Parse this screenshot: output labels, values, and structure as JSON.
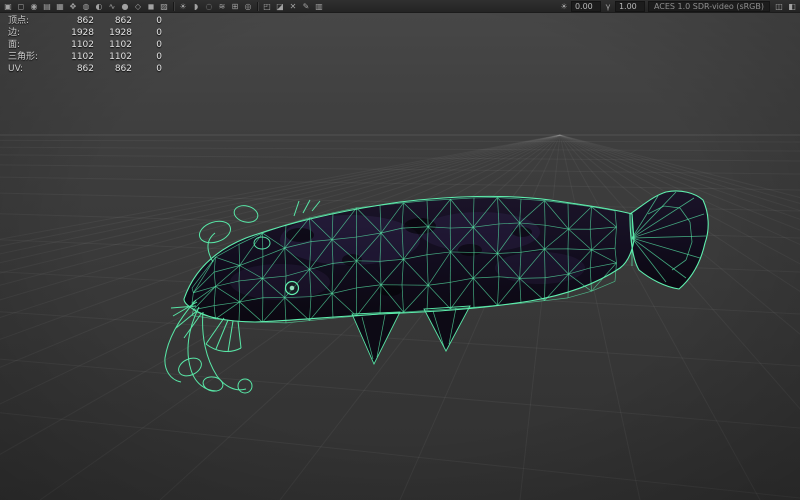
{
  "toolbar": {
    "icons_left": [
      {
        "name": "select-camera-icon",
        "glyph": "▣"
      },
      {
        "name": "lock-camera-icon",
        "glyph": "◻"
      },
      {
        "name": "camera-attributes-icon",
        "glyph": "◉"
      },
      {
        "name": "bookmarks-icon",
        "glyph": "▤"
      },
      {
        "name": "image-plane-icon",
        "glyph": "▦"
      },
      {
        "name": "pan-zoom-icon",
        "glyph": "✥"
      },
      {
        "name": "oversampling-icon",
        "glyph": "◍"
      },
      {
        "name": "backface-culling-icon",
        "glyph": "◐"
      },
      {
        "name": "smooth-wireframe-icon",
        "glyph": "∿"
      },
      {
        "name": "default-material-icon",
        "glyph": "●"
      },
      {
        "name": "wireframe-mode-icon",
        "glyph": "◇"
      },
      {
        "name": "shaded-mode-icon",
        "glyph": "◼"
      },
      {
        "name": "textured-mode-icon",
        "glyph": "▨"
      }
    ],
    "icons_mid": [
      {
        "name": "lighting-icon",
        "glyph": "☀"
      },
      {
        "name": "shadows-icon",
        "glyph": "◗"
      },
      {
        "name": "ambient-occlusion-icon",
        "glyph": "◌"
      },
      {
        "name": "motion-blur-icon",
        "glyph": "≋"
      },
      {
        "name": "multisampling-icon",
        "glyph": "⊞"
      },
      {
        "name": "depth-of-field-icon",
        "glyph": "◎"
      }
    ],
    "icons_right": [
      {
        "name": "isolate-select-icon",
        "glyph": "◰"
      },
      {
        "name": "xray-icon",
        "glyph": "◪"
      },
      {
        "name": "xray-joints-icon",
        "glyph": "✕"
      },
      {
        "name": "grease-pencil-icon",
        "glyph": "✎"
      },
      {
        "name": "grid-toggle-icon",
        "glyph": "▥"
      }
    ],
    "exposure_icon": "☀",
    "exposure_value": "0.00",
    "gamma_icon": "γ",
    "gamma_value": "1.00",
    "colorspace_label": "ACES 1.0 SDR-video (sRGB)",
    "icons_end": [
      {
        "name": "snapshot-icon",
        "glyph": "◫"
      },
      {
        "name": "render-view-icon",
        "glyph": "◧"
      }
    ]
  },
  "hud": {
    "rows": [
      {
        "label": "顶点:",
        "total": "862",
        "selected": "862",
        "extra": "0"
      },
      {
        "label": "边:",
        "total": "1928",
        "selected": "1928",
        "extra": "0"
      },
      {
        "label": "面:",
        "total": "1102",
        "selected": "1102",
        "extra": "0"
      },
      {
        "label": "三角形:",
        "total": "1102",
        "selected": "1102",
        "extra": "0"
      },
      {
        "label": "UV:",
        "total": "862",
        "selected": "862",
        "extra": "0"
      }
    ]
  },
  "colors": {
    "wireframe": "#58e6a6",
    "wireframe_bright": "#5fefae",
    "grid_line": "rgba(205,205,205,0.07)",
    "horizon_line": "rgba(205,205,205,0.14)",
    "body_dark": "#0c0913",
    "body_purple": "#1b1429"
  }
}
